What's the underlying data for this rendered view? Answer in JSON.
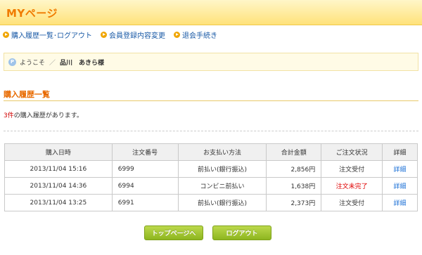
{
  "header": {
    "title": "MYページ"
  },
  "links": [
    {
      "label": "購入履歴一覧･ログアウト"
    },
    {
      "label": "会員登録内容変更"
    },
    {
      "label": "退会手続き"
    }
  ],
  "welcome": {
    "badge": "P",
    "greeting": "ようこそ",
    "separator": "／",
    "name": "品川　あきら様"
  },
  "history": {
    "title": "購入履歴一覧",
    "count": "3件",
    "count_suffix": "の購入履歴があります。",
    "columns": [
      "購入日時",
      "注文番号",
      "お支払い方法",
      "合計金額",
      "ご注文状況",
      "詳細"
    ],
    "rows": [
      {
        "date": "2013/11/04 15:16",
        "order_no": "6999",
        "payment": "前払い(銀行振込)",
        "total": "2,856円",
        "status": "注文受付",
        "detail": "詳細"
      },
      {
        "date": "2013/11/04 14:36",
        "order_no": "6994",
        "payment": "コンビニ前払い",
        "total": "1,638円",
        "status": "注文未完了",
        "detail": "詳細"
      },
      {
        "date": "2013/11/04 13:25",
        "order_no": "6991",
        "payment": "前払い(銀行振込)",
        "total": "2,373円",
        "status": "注文受付",
        "detail": "詳細"
      }
    ]
  },
  "buttons": {
    "top_page": "トップページへ",
    "logout": "ログアウト"
  },
  "colors": {
    "accent_orange": "#f07b00",
    "link_blue": "#1a5aa6",
    "button_green": "#8db51f",
    "status_red": "#e00000"
  }
}
